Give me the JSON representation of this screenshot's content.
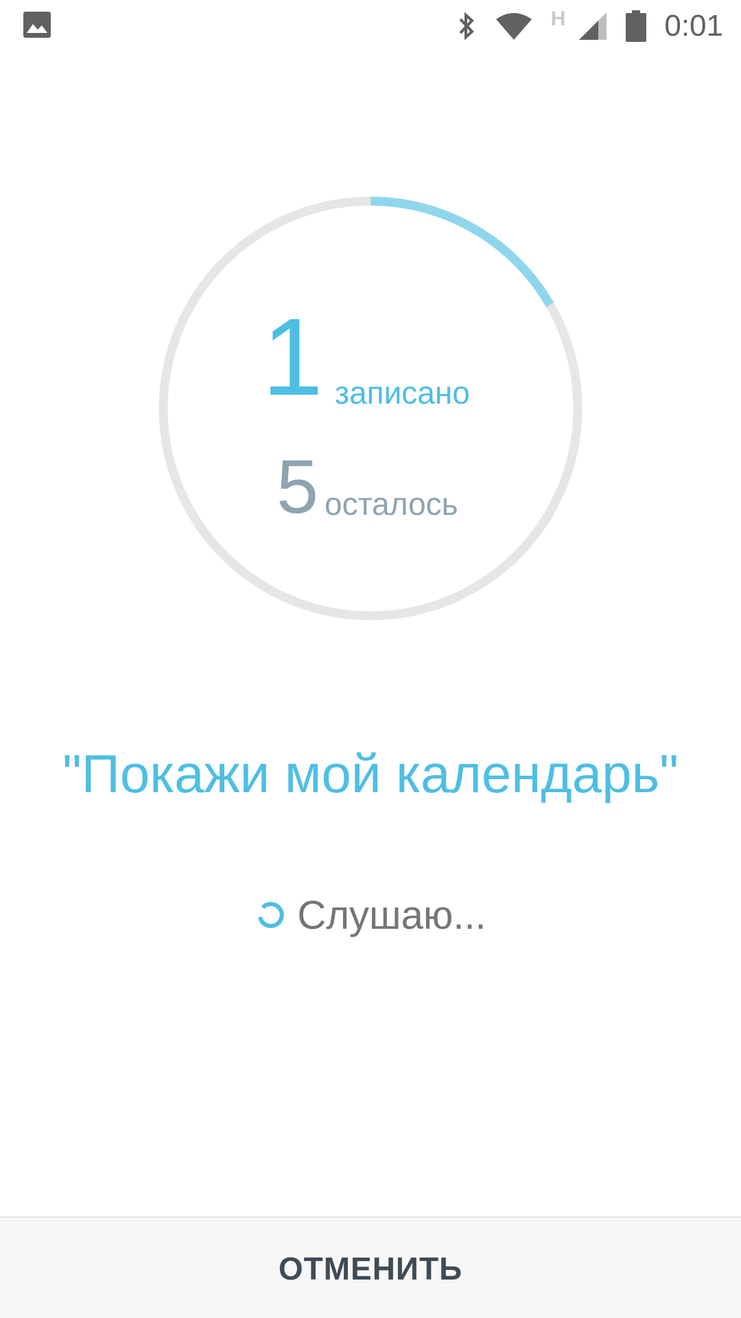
{
  "status_bar": {
    "left_icon": "image-icon",
    "icons": [
      "bluetooth-icon",
      "wifi-icon",
      "network-type-h",
      "cell-signal-icon",
      "battery-icon"
    ],
    "network_type": "H",
    "time": "0:01"
  },
  "progress": {
    "recorded_count": "1",
    "recorded_label": "записано",
    "remaining_count": "5",
    "remaining_label": "осталось",
    "completed_fraction": 0.1667,
    "accent_color": "#4ebee3",
    "track_color": "#e6e6e6"
  },
  "prompt": {
    "phrase": "\"Покажи мой календарь\""
  },
  "listening": {
    "icon": "loading-spinner-icon",
    "label": "Слушаю..."
  },
  "bottom_bar": {
    "cancel_label": "ОТМЕНИТЬ"
  }
}
